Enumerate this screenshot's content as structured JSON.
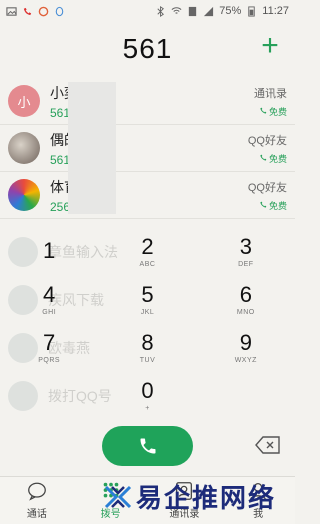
{
  "status": {
    "battery": "75%",
    "time": "11:27"
  },
  "dialer": {
    "typed_number": "561"
  },
  "suggestions": [
    {
      "name": "小奕",
      "number": "561",
      "source": "通讯录",
      "free": "免费",
      "avatar_text": "小",
      "avatar_color": "#e48a8f"
    },
    {
      "name": "偶的",
      "number": "561",
      "source": "QQ好友",
      "free": "免费",
      "avatar_text": "",
      "avatar_color": "#8b7a6e"
    },
    {
      "name": "体育",
      "number": "256",
      "source": "QQ好友",
      "free": "免费",
      "avatar_text": "",
      "avatar_color": "#3b6d9a"
    }
  ],
  "ghost_list": [
    "章鱼输入法",
    "疾风下载",
    "欧毒燕",
    "拨打QQ号"
  ],
  "keys": [
    {
      "digit": "1",
      "letters": ""
    },
    {
      "digit": "2",
      "letters": "ABC"
    },
    {
      "digit": "3",
      "letters": "DEF"
    },
    {
      "digit": "4",
      "letters": "GHI"
    },
    {
      "digit": "5",
      "letters": "JKL"
    },
    {
      "digit": "6",
      "letters": "MNO"
    },
    {
      "digit": "7",
      "letters": "PQRS"
    },
    {
      "digit": "8",
      "letters": "TUV"
    },
    {
      "digit": "9",
      "letters": "WXYZ"
    },
    {
      "digit": "",
      "letters": ""
    },
    {
      "digit": "0",
      "letters": "+"
    },
    {
      "digit": "",
      "letters": ""
    }
  ],
  "tabs": [
    {
      "label": "通话",
      "icon": "chat-bubble-icon"
    },
    {
      "label": "拨号",
      "icon": "dialpad-icon"
    },
    {
      "label": "通讯录",
      "icon": "contacts-icon"
    },
    {
      "label": "我",
      "icon": "person-icon"
    }
  ],
  "watermark": "易企推网络",
  "colors": {
    "accent": "#27a05a",
    "call_button": "#1fa35a",
    "background": "#f3f2ee"
  }
}
